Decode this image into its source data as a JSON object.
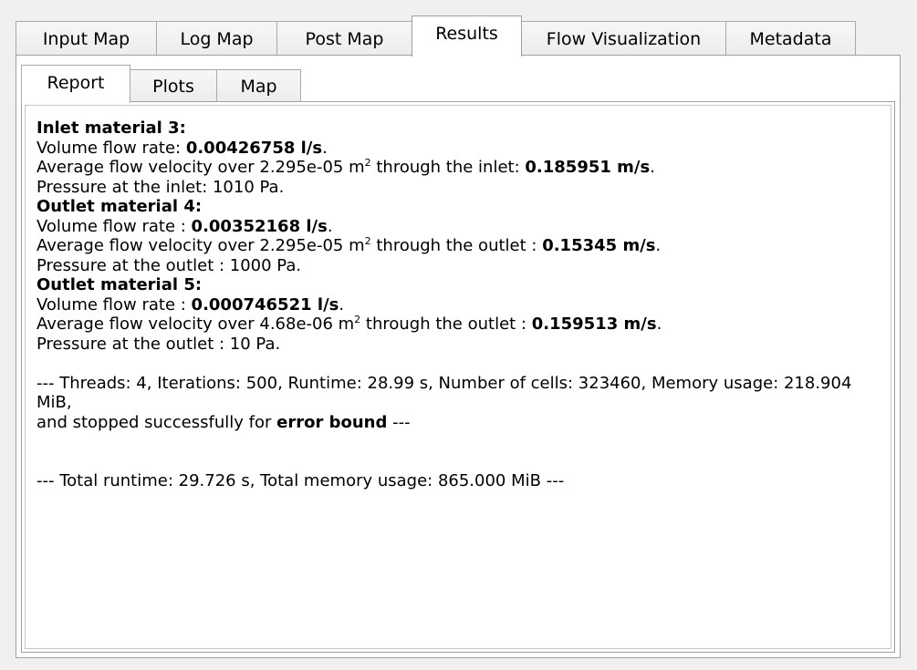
{
  "top_tabs": [
    "Input Map",
    "Log Map",
    "Post Map",
    "Results",
    "Flow Visualization",
    "Metadata"
  ],
  "active_top_tab": "Results",
  "sub_tabs": [
    "Report",
    "Plots",
    "Map"
  ],
  "active_sub_tab": "Report",
  "report": {
    "inlet3": {
      "heading": "Inlet material 3:",
      "flow_prefix": "Volume flow rate: ",
      "flow_value": "0.00426758 l/s",
      "flow_suffix": ".",
      "vel_prefix": "Average flow velocity over 2.295e-05 m",
      "vel_sup": "2",
      "vel_mid": " through the inlet: ",
      "vel_value": "0.185951 m/s",
      "vel_suffix": ".",
      "pressure": "Pressure at the inlet: 1010 Pa."
    },
    "outlet4": {
      "heading": "Outlet material 4:",
      "flow_prefix": "Volume flow rate : ",
      "flow_value": "0.00352168 l/s",
      "flow_suffix": ".",
      "vel_prefix": "Average flow velocity over 2.295e-05 m",
      "vel_sup": "2",
      "vel_mid": " through the outlet : ",
      "vel_value": "0.15345 m/s",
      "vel_suffix": ".",
      "pressure": "Pressure at the outlet : 1000 Pa."
    },
    "outlet5": {
      "heading": "Outlet material 5:",
      "flow_prefix": "Volume flow rate : ",
      "flow_value": "0.000746521 l/s",
      "flow_suffix": ".",
      "vel_prefix": "Average flow velocity over 4.68e-06 m",
      "vel_sup": "2",
      "vel_mid": " through the outlet : ",
      "vel_value": "0.159513 m/s",
      "vel_suffix": ".",
      "pressure": "Pressure at the outlet : 10 Pa."
    },
    "stats_line": "--- Threads: 4, Iterations: 500, Runtime: 28.99 s, Number of cells: 323460, Memory usage: 218.904 MiB,",
    "stopped_prefix": "and stopped successfully for ",
    "stopped_bold": "error bound",
    "stopped_suffix": " ---",
    "total_line": "--- Total runtime: 29.726 s, Total memory usage: 865.000 MiB ---"
  }
}
